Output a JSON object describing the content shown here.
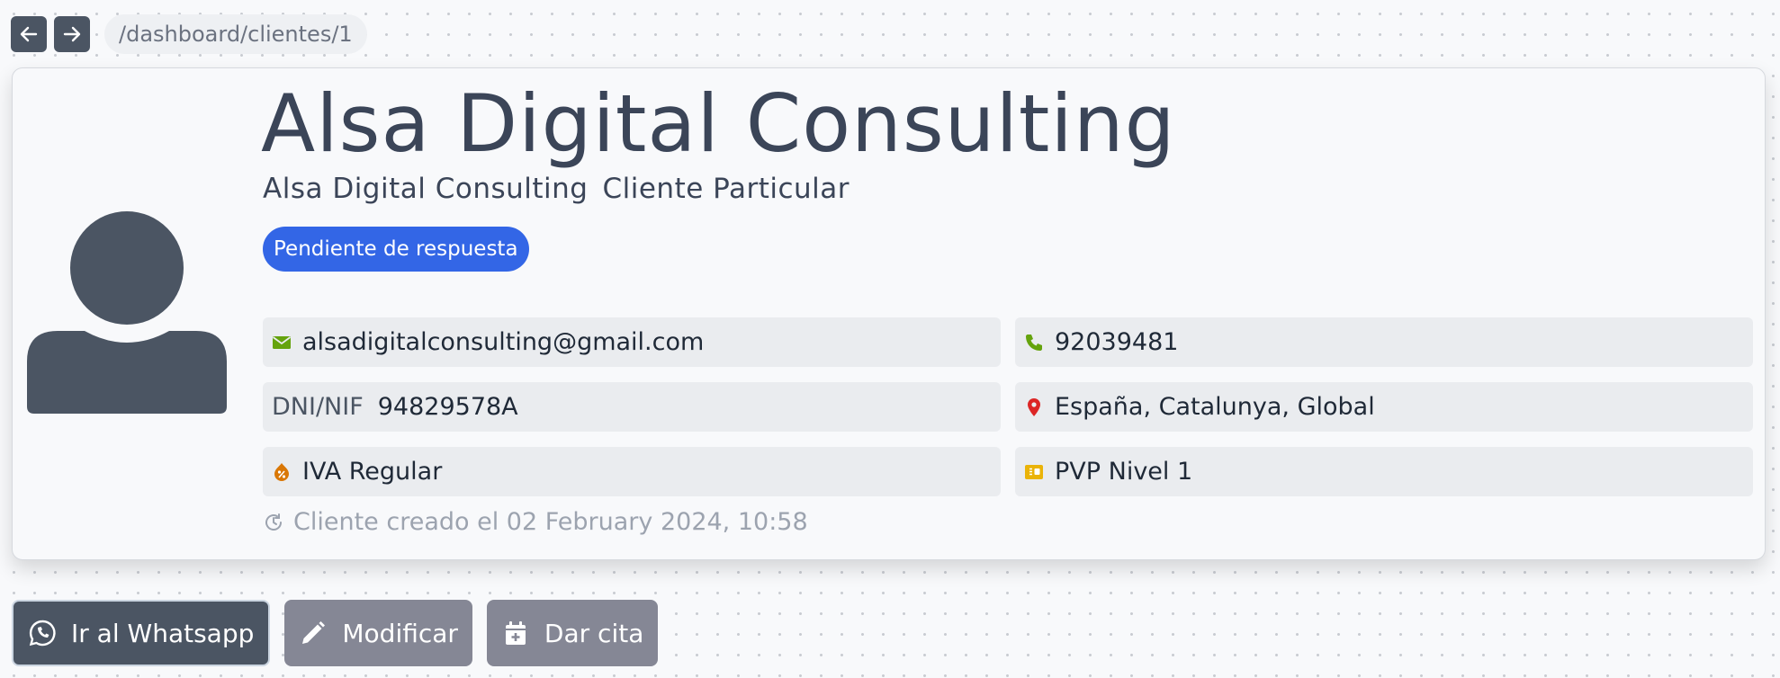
{
  "breadcrumb": {
    "path": "/dashboard/clientes/1"
  },
  "client": {
    "name": "Alsa Digital Consulting",
    "legal_name": "Alsa Digital Consulting",
    "type": "Cliente Particular",
    "status": "Pendiente de respuesta",
    "email": "alsadigitalconsulting@gmail.com",
    "phone": "92039481",
    "dni_label": "DNI/NIF",
    "dni": "94829578A",
    "location": "España, Catalunya, Global",
    "tax": "IVA Regular",
    "price_level": "PVP Nivel 1",
    "created": "Cliente creado el 02 February 2024, 10:58"
  },
  "actions": {
    "whatsapp": "Ir al Whatsapp",
    "edit": "Modificar",
    "appointment": "Dar cita"
  },
  "icons": {
    "back": "arrow-left-icon",
    "forward": "arrow-right-icon",
    "avatar": "user-silhouette-icon",
    "email": "envelope-icon",
    "phone": "phone-icon",
    "location": "map-pin-icon",
    "tax": "percent-badge-icon",
    "price": "price-tag-icon",
    "clock": "clock-icon",
    "whatsapp": "whatsapp-icon",
    "edit": "pencil-icon",
    "calendar": "calendar-plus-icon"
  },
  "colors": {
    "status_badge": "#3366e6",
    "email_icon": "#65a30d",
    "phone_icon": "#65a30d",
    "location_icon": "#dc2626",
    "tax_icon": "#d97706",
    "price_icon": "#eab308",
    "primary_button": "#4b5563",
    "muted_button": "#858795"
  }
}
